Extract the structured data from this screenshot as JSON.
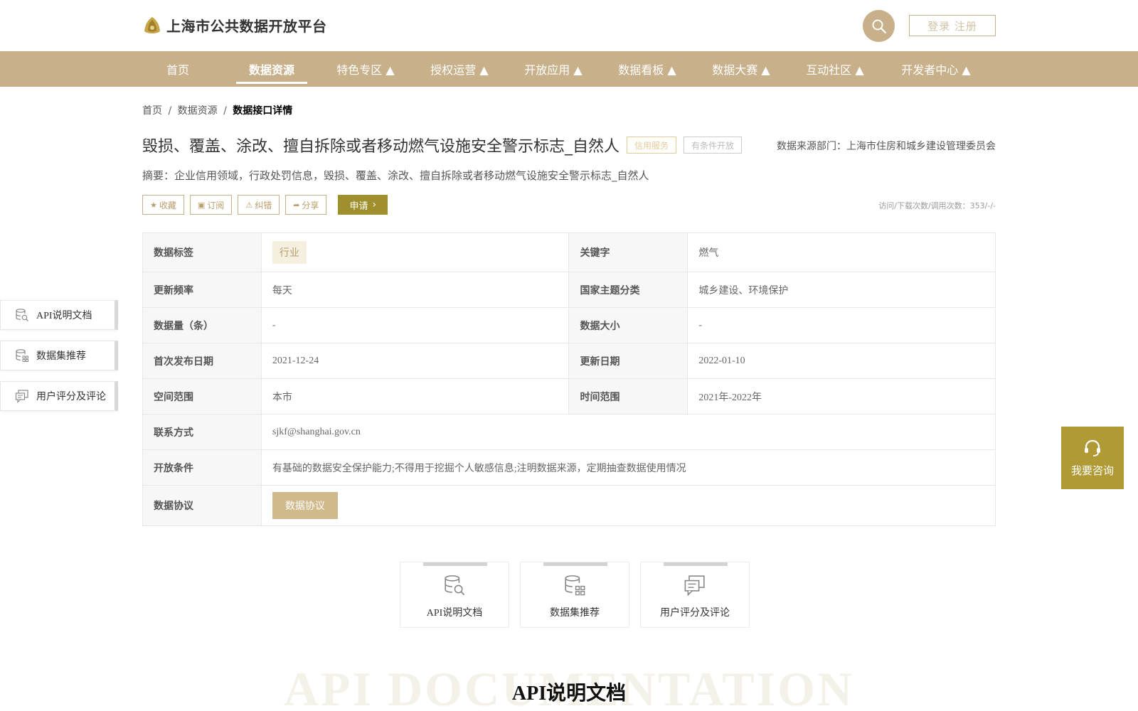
{
  "header": {
    "site_title": "上海市公共数据开放平台",
    "login_label": "登录 注册"
  },
  "nav": {
    "items": [
      {
        "label": "首页"
      },
      {
        "label": "数据资源"
      },
      {
        "label": "特色专区 ▲"
      },
      {
        "label": "授权运营 ▲"
      },
      {
        "label": "开放应用 ▲"
      },
      {
        "label": "数据看板 ▲"
      },
      {
        "label": "数据大赛 ▲"
      },
      {
        "label": "互动社区 ▲"
      },
      {
        "label": "开发者中心 ▲"
      }
    ],
    "active_index": 1
  },
  "breadcrumb": {
    "home": "首页",
    "sep1": "/",
    "resources": "数据资源",
    "sep2": "/",
    "current": "数据接口详情"
  },
  "detail": {
    "title": "毁损、覆盖、涂改、擅自拆除或者移动燃气设施安全警示标志_自然人",
    "tag_credit": "信用服务",
    "tag_condition": "有条件开放",
    "source": "数据来源部门：上海市住房和城乡建设管理委员会",
    "summary": "摘要：企业信用领域，行政处罚信息，毁损、覆盖、涂改、擅自拆除或者移动燃气设施安全警示标志_自然人"
  },
  "actions": {
    "favorite": "收藏",
    "subscribe": "订阅",
    "report": "纠错",
    "share": "分享",
    "apply": "申请",
    "stats": "访问/下载次数/调用次数：353/-/-"
  },
  "table": {
    "data_tag_label": "数据标签",
    "data_tag_value": "行业",
    "keyword_label": "关键字",
    "keyword_value": "燃气",
    "freq_label": "更新频率",
    "freq_value": "每天",
    "theme_label": "国家主题分类",
    "theme_value": "城乡建设、环境保护",
    "count_label": "数据量（条）",
    "count_value": "-",
    "size_label": "数据大小",
    "size_value": "-",
    "first_pub_label": "首次发布日期",
    "first_pub_value": "2021-12-24",
    "update_label": "更新日期",
    "update_value": "2022-01-10",
    "space_label": "空间范围",
    "space_value": "本市",
    "time_label": "时间范围",
    "time_value": "2021年-2022年",
    "contact_label": "联系方式",
    "contact_value": "sjkf@shanghai.gov.cn",
    "cond_label": "开放条件",
    "cond_value": "有基础的数据安全保护能力;不得用于挖掘个人敏感信息;注明数据来源，定期抽查数据使用情况",
    "protocol_label": "数据协议",
    "protocol_button": "数据协议"
  },
  "side_nav": {
    "items": [
      {
        "label": "API说明文档",
        "icon": "api-doc-icon"
      },
      {
        "label": "数据集推荐",
        "icon": "dataset-icon"
      },
      {
        "label": "用户评分及评论",
        "icon": "comment-icon"
      }
    ]
  },
  "consult": {
    "label": "我要咨询"
  },
  "bottom_tabs": {
    "items": [
      {
        "label": "API说明文档"
      },
      {
        "label": "数据集推荐"
      },
      {
        "label": "用户评分及评论"
      }
    ]
  },
  "section": {
    "bg_word": "API DOCUMENTATION",
    "title": "API说明文档"
  },
  "colors": {
    "brand": "#c7b08a",
    "apply": "#a08f2d",
    "consult": "#b09a36"
  }
}
